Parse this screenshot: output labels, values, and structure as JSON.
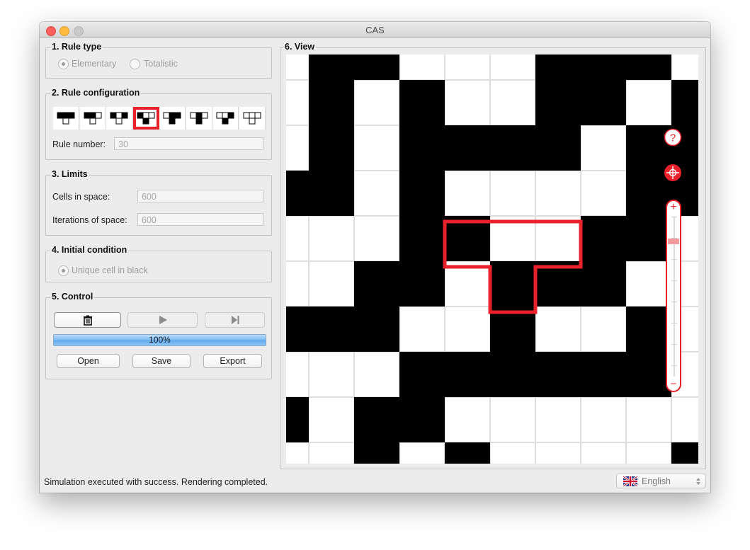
{
  "window": {
    "title": "CAS"
  },
  "rule_type": {
    "legend": "1. Rule type",
    "options": [
      "Elementary",
      "Totalistic"
    ],
    "selected": "Elementary"
  },
  "rule_config": {
    "legend": "2. Rule configuration",
    "selected_index": 3,
    "rule_number_label": "Rule number:",
    "rule_number": "30"
  },
  "limits": {
    "legend": "3. Limits",
    "cells_label": "Cells in space:",
    "cells_value": "600",
    "iterations_label": "Iterations of space:",
    "iterations_value": "600"
  },
  "initial_condition": {
    "legend": "4. Initial condition",
    "option": "Unique cell in black"
  },
  "control": {
    "legend": "5. Control",
    "progress_percent": 100,
    "progress_text": "100%",
    "open_label": "Open",
    "save_label": "Save",
    "export_label": "Export"
  },
  "view": {
    "legend": "6. View",
    "grid": [
      "0110001110",
      "0101001101",
      "0101111011",
      "1101000011",
      "0001100110",
      "0011011100",
      "1110010010",
      "0001111110",
      "1011000000",
      "0010100001"
    ],
    "zoom_plus": "+",
    "zoom_minus": "−",
    "help_icon_text": "?"
  },
  "status": {
    "message": "Simulation executed with success. Rendering completed.",
    "language": "English"
  },
  "colors": {
    "accent": "#e8212b",
    "cell_on": "#000000",
    "cell_off": "#ffffff"
  }
}
